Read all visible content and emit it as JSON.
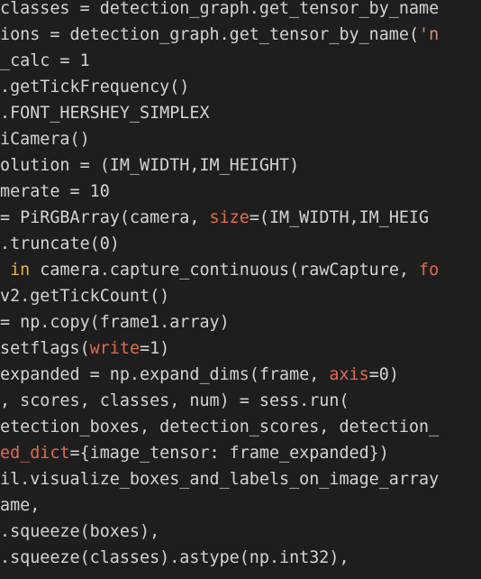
{
  "colors": {
    "background": "#1e1e1e",
    "default_text": "#d4d4d4",
    "keyword_param": "#e06c4e",
    "keyword_for": "#e8b04a",
    "string": "#ce9178"
  },
  "code_lines": [
    [
      {
        "t": "classes = detection_graph.get_tensor_by_name",
        "c": "default"
      }
    ],
    [
      {
        "t": "ions = detection_graph.get_tensor_by_name(",
        "c": "default"
      },
      {
        "t": "'n",
        "c": "string"
      }
    ],
    [
      {
        "t": "_calc = 1",
        "c": "default"
      }
    ],
    [
      {
        "t": ".getTickFrequency()",
        "c": "default"
      }
    ],
    [
      {
        "t": ".FONT_HERSHEY_SIMPLEX",
        "c": "default"
      }
    ],
    [
      {
        "t": "iCamera()",
        "c": "default"
      }
    ],
    [
      {
        "t": "olution = (IM_WIDTH,IM_HEIGHT)",
        "c": "default"
      }
    ],
    [
      {
        "t": "merate = 10",
        "c": "default"
      }
    ],
    [
      {
        "t": "= PiRGBArray(camera, ",
        "c": "default"
      },
      {
        "t": "size",
        "c": "param"
      },
      {
        "t": "=(IM_WIDTH,IM_HEIG",
        "c": "default"
      }
    ],
    [
      {
        "t": ".truncate(0)",
        "c": "default"
      }
    ],
    [
      {
        "t": " ",
        "c": "default"
      },
      {
        "t": "in",
        "c": "keyword"
      },
      {
        "t": " camera.capture_continuous(rawCapture, ",
        "c": "default"
      },
      {
        "t": "fo",
        "c": "param"
      }
    ],
    [
      {
        "t": "v2.getTickCount()",
        "c": "default"
      }
    ],
    [
      {
        "t": "= np.copy(frame1.array)",
        "c": "default"
      }
    ],
    [
      {
        "t": "setflags(",
        "c": "default"
      },
      {
        "t": "write",
        "c": "param"
      },
      {
        "t": "=1)",
        "c": "default"
      }
    ],
    [
      {
        "t": "expanded = np.expand_dims(frame, ",
        "c": "default"
      },
      {
        "t": "axis",
        "c": "param"
      },
      {
        "t": "=0)",
        "c": "default"
      }
    ],
    [
      {
        "t": ", scores, classes, num) = sess.run(",
        "c": "default"
      }
    ],
    [
      {
        "t": "etection_boxes, detection_scores, detection_",
        "c": "default"
      }
    ],
    [
      {
        "t": "ed_dict",
        "c": "param"
      },
      {
        "t": "={image_tensor: frame_expanded})",
        "c": "default"
      }
    ],
    [
      {
        "t": "il.visualize_boxes_and_labels_on_image_array",
        "c": "default"
      }
    ],
    [
      {
        "t": "ame,",
        "c": "default"
      }
    ],
    [
      {
        "t": ".squeeze(boxes),",
        "c": "default"
      }
    ],
    [
      {
        "t": ".squeeze(classes).astype(np.int32),",
        "c": "default"
      }
    ]
  ]
}
